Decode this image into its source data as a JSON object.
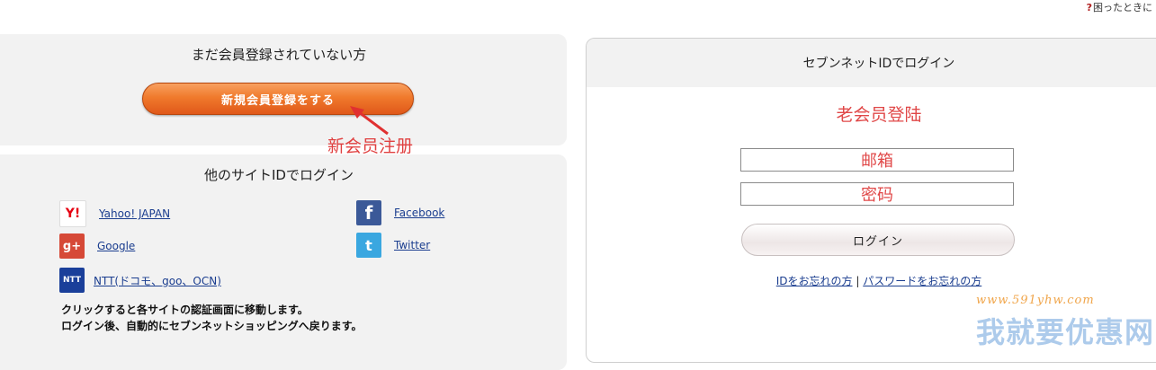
{
  "header": {
    "help_label": "困ったときに"
  },
  "register": {
    "title": "まだ会員登録されていない方",
    "button_label": "新規会員登録をする",
    "annotation": "新会员注册"
  },
  "social": {
    "title": "他のサイトIDでログイン",
    "providers": [
      {
        "label": "Yahoo! JAPAN",
        "icon": "yahoo-icon",
        "glyph": "Y!"
      },
      {
        "label": "Google",
        "icon": "google-icon",
        "glyph": "g+"
      },
      {
        "label": "NTT(ドコモ、goo、OCN)",
        "icon": "ntt-icon",
        "glyph": "NTT"
      },
      {
        "label": "Facebook",
        "icon": "facebook-icon",
        "glyph": "f"
      },
      {
        "label": "Twitter",
        "icon": "twitter-icon",
        "glyph": "t"
      }
    ],
    "note_line1": "クリックすると各サイトの認証画面に移動します。",
    "note_line2": "ログイン後、自動的にセブンネットショッピングへ戻ります。"
  },
  "login": {
    "title": "セブンネットIDでログイン",
    "annotation": "老会员登陆",
    "email_annotation": "邮箱",
    "password_annotation": "密码",
    "button_label": "ログイン",
    "forgot_id": "IDをお忘れの方",
    "separator": "|",
    "forgot_password": "パスワードをお忘れの方"
  },
  "watermark": {
    "url": "www.591yhw.com",
    "text": "我就要优惠网"
  },
  "colors": {
    "orange": "#f07a2c",
    "annotation_red": "#e04848",
    "link_blue": "#1a3d8f"
  }
}
